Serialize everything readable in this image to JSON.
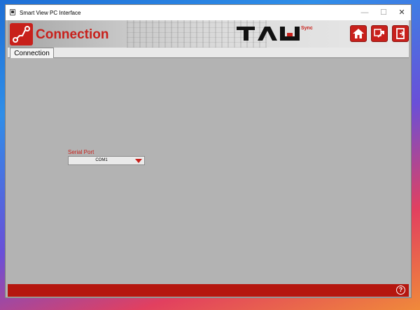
{
  "window": {
    "title": "Smart View PC Interface",
    "controls": {
      "minimize": "—",
      "maximize": "☐",
      "close": "✕"
    }
  },
  "header": {
    "page_title": "Connection",
    "page_icon": "connection-icon",
    "logo_text": "TAU",
    "logo_suffix": "Sync",
    "buttons": [
      {
        "name": "home",
        "icon": "home-icon"
      },
      {
        "name": "switch",
        "icon": "swap-icon"
      },
      {
        "name": "exit",
        "icon": "exit-door-icon"
      }
    ]
  },
  "tabs": [
    {
      "label": "Connection",
      "active": true
    }
  ],
  "form": {
    "serial_port_label": "Serial Port",
    "serial_port_value": "COM1"
  },
  "footer": {
    "help_label": "?"
  },
  "colors": {
    "accent": "#c8201b",
    "content_bg": "#b3b3b3",
    "footer": "#b5160f"
  }
}
